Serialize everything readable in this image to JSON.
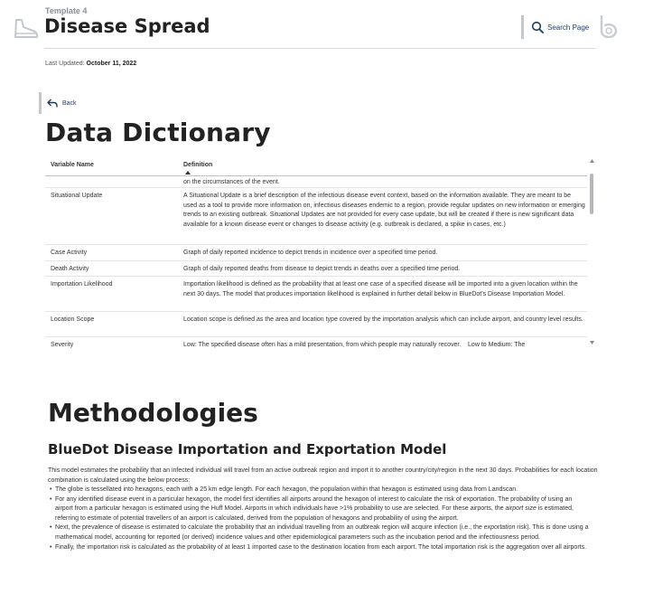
{
  "header": {
    "template_label": "Template 4",
    "title": "Disease Spread",
    "search_label": "Search Page"
  },
  "updated": {
    "label": "Last Updated:",
    "date": "October 11, 2022"
  },
  "back_label": "Back",
  "data_dictionary": {
    "heading": "Data Dictionary",
    "columns": [
      "Variable Name",
      "Definition"
    ],
    "partial_top_text": "on the circumstances of the event.",
    "rows": [
      {
        "name": "Situational Update",
        "definition": "A Situational Update is a brief description of the infectious disease event context, based on the information available. They are meant to be used as a tool to provide more information on, infectious diseases endemic to a region, provide regular updates on new information or emerging trends to an existing outbreak. Situational Updates are not provided for every case update, but will be created if there is new significant data available for a known disease event or changes to disease activity (e.g. outbreak is declared, a spike in cases, etc.)"
      },
      {
        "name": "Case Activity",
        "definition": "Graph of daily reported incidence to depict trends in incidence over a specified time period."
      },
      {
        "name": "Death Activity",
        "definition": "Graph of daily reported deaths from disease to depict trends in deaths over a specified time period."
      },
      {
        "name": "Importation Likelihood",
        "definition": "Importation likelihood is defined as the probability that at least one case of a specified disease will be imported into a given location within the next 30 days. The model that produces importation likelihood is explained in further detail below in BlueDot's Disease Importation Model."
      },
      {
        "name": "Location Scope",
        "definition": "Location scope is defined as the area and location type covered by the importation analysis which can include airport, and country level results."
      },
      {
        "name": "Severity",
        "definition": "Low: The specified disease often has a mild presentation, from which people may naturally recover.    Low to Medium: The"
      }
    ]
  },
  "methodologies": {
    "heading": "Methodologies",
    "model_heading": "BlueDot Disease Importation and Exportation Model",
    "intro": "This model estimates the probability that an infected individual will travel from an active outbreak region and import it to another country/city/region in the next 30 days. Probabilities for each location combination is calculated using the below process:",
    "bullets": [
      {
        "parts": [
          {
            "t": "The globe is tessellated into hexagons, each with a 25 km edge length. For each hexagon, the population within that hexagon is estimated using  data from Landscan."
          }
        ]
      },
      {
        "parts": [
          {
            "t": "For any identified disease event in a particular hexagon, the model first identifies all airports around the hexagon of interest to calculate the risk of exportation. The probability of using an airport from a particular hexagon is estimated using the Huff Model. Airports in which individuals have >1% probability to use are selected. For these airports, the "
          },
          {
            "t": "airport size",
            "i": true
          },
          {
            "t": " is estimated, referring to estimate of potential travellers of an airport is calculated, derived from the population of hexagons and probability of using the airport."
          }
        ]
      },
      {
        "parts": [
          {
            "t": "Next, the prevalence of disease is estimated to calculate the probability that an individual travelling from an outbreak region will acquire infection (i.e., the "
          },
          {
            "t": "exportation",
            "i": true
          },
          {
            "t": " risk). This is done using a mathematical model, accounting for reported (or derived) incidence values and other epidemiological parameters such as the incubation period and the infectiousness period."
          }
        ]
      },
      {
        "parts": [
          {
            "t": "Finally, the importation risk is calculated as the probability of at least 1 imported case to the destination location from each airport. The total importation risk is the aggregation over all airports."
          }
        ]
      }
    ]
  },
  "colors": {
    "accent_border": "#c3c8cf",
    "link_text": "#1f3a5f",
    "logo": "#c7ccd3"
  }
}
